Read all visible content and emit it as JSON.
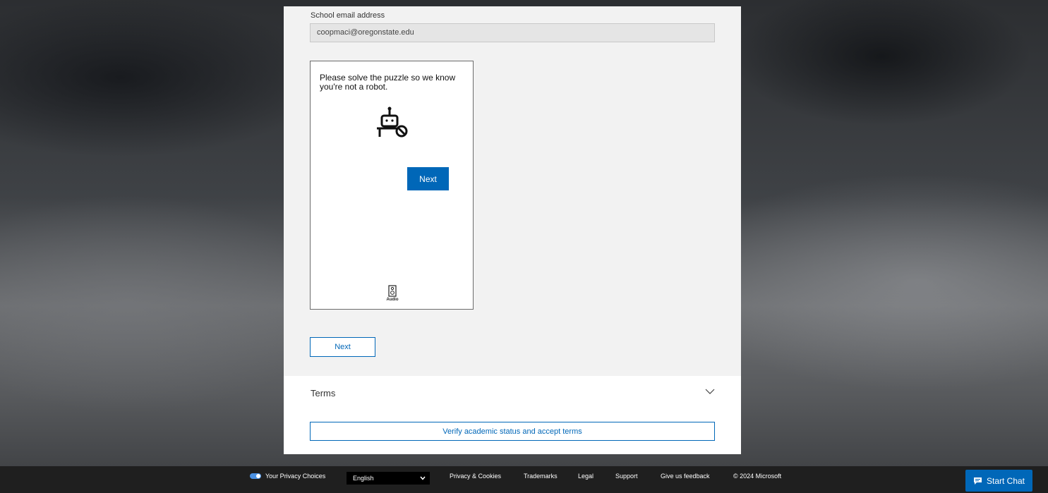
{
  "form": {
    "email_label": "School email address",
    "email_value": "coopmaci@oregonstate.edu",
    "next_label": "Next"
  },
  "captcha": {
    "prompt": "Please solve the puzzle so we know you're not a robot.",
    "next_label": "Next",
    "audio_label": "Audio",
    "icon": "robot-blocked-icon"
  },
  "terms": {
    "label": "Terms",
    "verify_label": "Verify academic status and accept terms"
  },
  "footer": {
    "privacy_choices": "Your Privacy Choices",
    "language": "English",
    "links": [
      "Privacy & Cookies",
      "Trademarks",
      "Legal",
      "Support",
      "Give us feedback"
    ],
    "copyright": "© 2024 Microsoft"
  },
  "chat": {
    "label": "Start Chat"
  },
  "colors": {
    "accent": "#0067b8",
    "footer_bg": "#1f1f1f",
    "panel_bg": "#f2f2f2"
  }
}
